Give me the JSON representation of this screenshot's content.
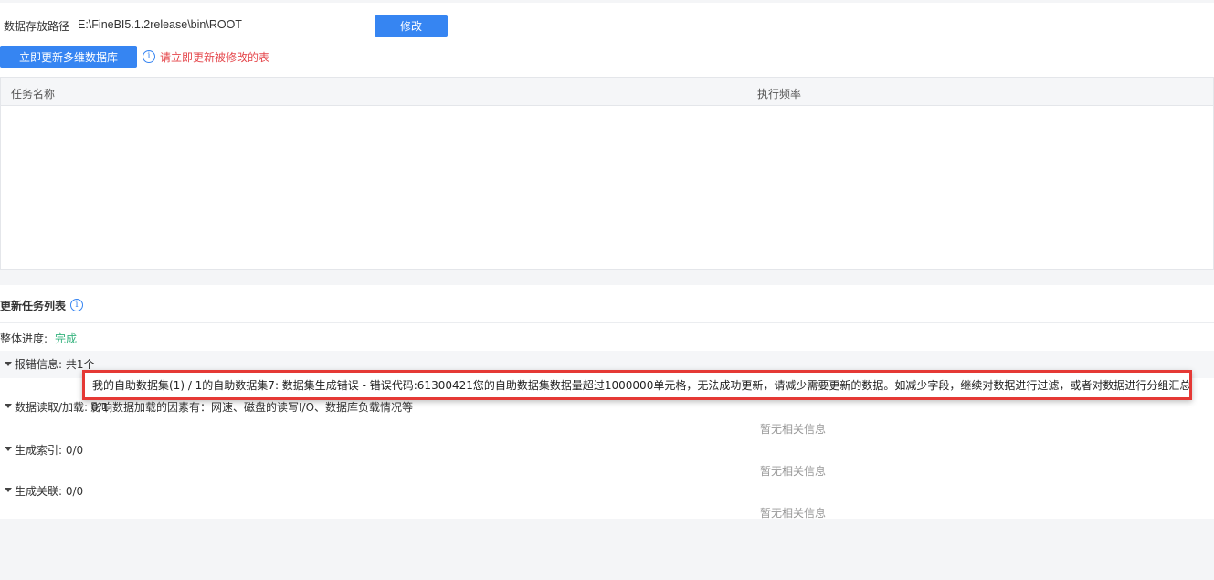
{
  "config": {
    "path_label": "数据存放路径",
    "path_value": "E:\\FineBI5.1.2release\\bin\\ROOT",
    "modify_button": "修改",
    "update_button": "立即更新多维数据库",
    "update_hint": "请立即更新被修改的表"
  },
  "table": {
    "columns": [
      "任务名称",
      "执行频率"
    ]
  },
  "task_list": {
    "title": "更新任务列表",
    "progress_label": "整体进度:",
    "progress_value": "完成",
    "sections": {
      "errors": {
        "label": "报错信息: 共1个"
      },
      "read": {
        "label": "数据读取/加载: 0/1",
        "description": "影响数据加载的因素有：网速、磁盘的读写I/O、数据库负载情况等",
        "empty": "暂无相关信息"
      },
      "index": {
        "label": "生成索引: 0/0",
        "empty": "暂无相关信息"
      },
      "relation": {
        "label": "生成关联: 0/0",
        "empty": "暂无相关信息"
      }
    }
  },
  "tooltip": {
    "text": "我的自助数据集(1) / 1的自助数据集7: 数据集生成错误 - 错误代码:61300421您的自助数据集数据量超过1000000单元格，无法成功更新，请减少需要更新的数据。如减少字段，继续对数据进行过滤，或者对数据进行分组汇总"
  },
  "colors": {
    "primary": "#3685f2",
    "hint_red": "#e5484d",
    "success_green": "#36b37e",
    "tooltip_border": "#e53935"
  },
  "icons": [
    "info-icon",
    "caret-down-icon"
  ]
}
